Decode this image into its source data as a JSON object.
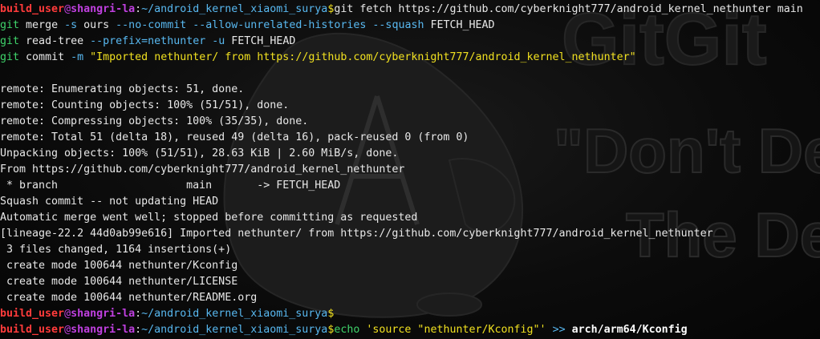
{
  "wallpaper": {
    "logo_text": "GitGit",
    "quote_line1": "\"Don't De",
    "quote_line2": "The Deb"
  },
  "terminal": {
    "prompt": {
      "user": "build_user",
      "at": "@",
      "host": "shangri-la",
      "sep": ":",
      "path": "~/android_kernel_xiaomi_surya",
      "symbol": "$"
    },
    "cmd1": {
      "text": "git fetch https://github.com/cyberknight777/android_kernel_nethunter main"
    },
    "cmd2": {
      "git": "git",
      "sub": "merge",
      "opt1": "-s",
      "val1": "ours",
      "opt2": "--no-commit",
      "opt3": "--allow-unrelated-histories",
      "opt4": "--squash",
      "arg": "FETCH_HEAD"
    },
    "cmd3": {
      "git": "git",
      "sub": "read-tree",
      "opt1": "--prefix=nethunter",
      "opt2": "-u",
      "arg": "FETCH_HEAD"
    },
    "cmd4": {
      "git": "git",
      "sub": "commit",
      "opt1": "-m",
      "msg": "\"Imported nethunter/ from https://github.com/cyberknight777/android_kernel_nethunter\""
    },
    "output": [
      "remote: Enumerating objects: 51, done.",
      "remote: Counting objects: 100% (51/51), done.",
      "remote: Compressing objects: 100% (35/35), done.",
      "remote: Total 51 (delta 18), reused 49 (delta 16), pack-reused 0 (from 0)",
      "Unpacking objects: 100% (51/51), 28.63 KiB | 2.60 MiB/s, done.",
      "From https://github.com/cyberknight777/android_kernel_nethunter",
      " * branch                    main       -> FETCH_HEAD",
      "Squash commit -- not updating HEAD",
      "Automatic merge went well; stopped before committing as requested",
      "[lineage-22.2 44d0ab99e616] Imported nethunter/ from https://github.com/cyberknight777/android_kernel_nethunter",
      " 3 files changed, 1164 insertions(+)",
      " create mode 100644 nethunter/Kconfig",
      " create mode 100644 nethunter/LICENSE",
      " create mode 100644 nethunter/README.org"
    ],
    "last_cmd": {
      "echo": "echo",
      "str": "'source \"nethunter/Kconfig\"'",
      "redir": ">>",
      "target": "arch/arm64/Kconfig"
    }
  },
  "colors": {
    "user": "#ff3b3b",
    "host": "#c040e0",
    "path": "#58b8f0",
    "prompt_symbol": "#f0e020",
    "git_command": "#3fd36a"
  }
}
